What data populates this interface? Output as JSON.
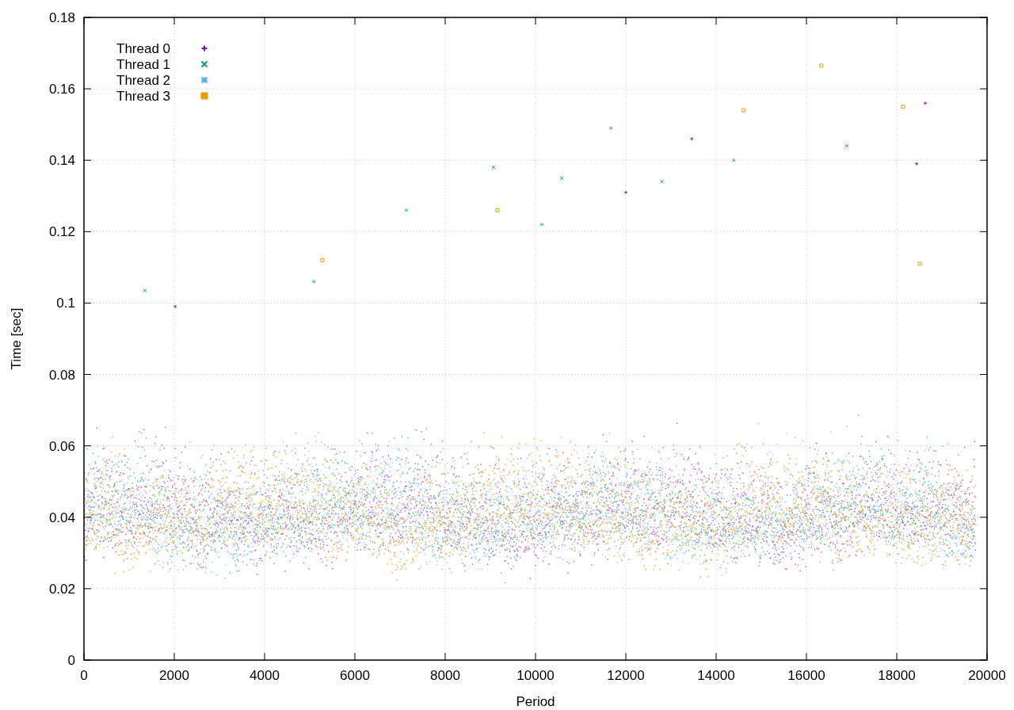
{
  "chart_data": {
    "type": "scatter",
    "xlabel": "Period",
    "ylabel": "Time [sec]",
    "grid": true,
    "legend": "top-left",
    "xlim": [
      0,
      20000
    ],
    "ylim": [
      0,
      0.18
    ],
    "xticks": [
      0,
      2000,
      4000,
      6000,
      8000,
      10000,
      12000,
      14000,
      16000,
      18000,
      20000
    ],
    "yticks": [
      0,
      0.02,
      0.04,
      0.06,
      0.08,
      {
        "value": 0.1,
        "label": "0.1"
      },
      0.12,
      0.14,
      0.16,
      0.18
    ],
    "series": [
      {
        "name": "Thread 0",
        "color": "#9400d3",
        "x": [
          18630,
          18440,
          13460,
          2020,
          12000
        ],
        "values": [
          0.156,
          0.139,
          0.146,
          0.099,
          0.131
        ]
      },
      {
        "name": "Thread 1",
        "color": "#009e73",
        "x": [
          9070,
          16890,
          12800,
          1350,
          10580
        ],
        "values": [
          0.138,
          0.144,
          0.134,
          0.1035,
          0.135
        ]
      },
      {
        "name": "Thread 2",
        "color": "#56b4e9",
        "x": [
          10140,
          11670,
          14390,
          5090,
          7140
        ],
        "values": [
          0.122,
          0.149,
          0.14,
          0.106,
          0.126
        ]
      },
      {
        "name": "Thread 3",
        "color": "#e69f00",
        "x": [
          16330,
          14610,
          18140,
          9160,
          5280,
          18510
        ],
        "values": [
          0.1665,
          0.154,
          0.155,
          0.126,
          0.112,
          0.111
        ]
      }
    ]
  }
}
